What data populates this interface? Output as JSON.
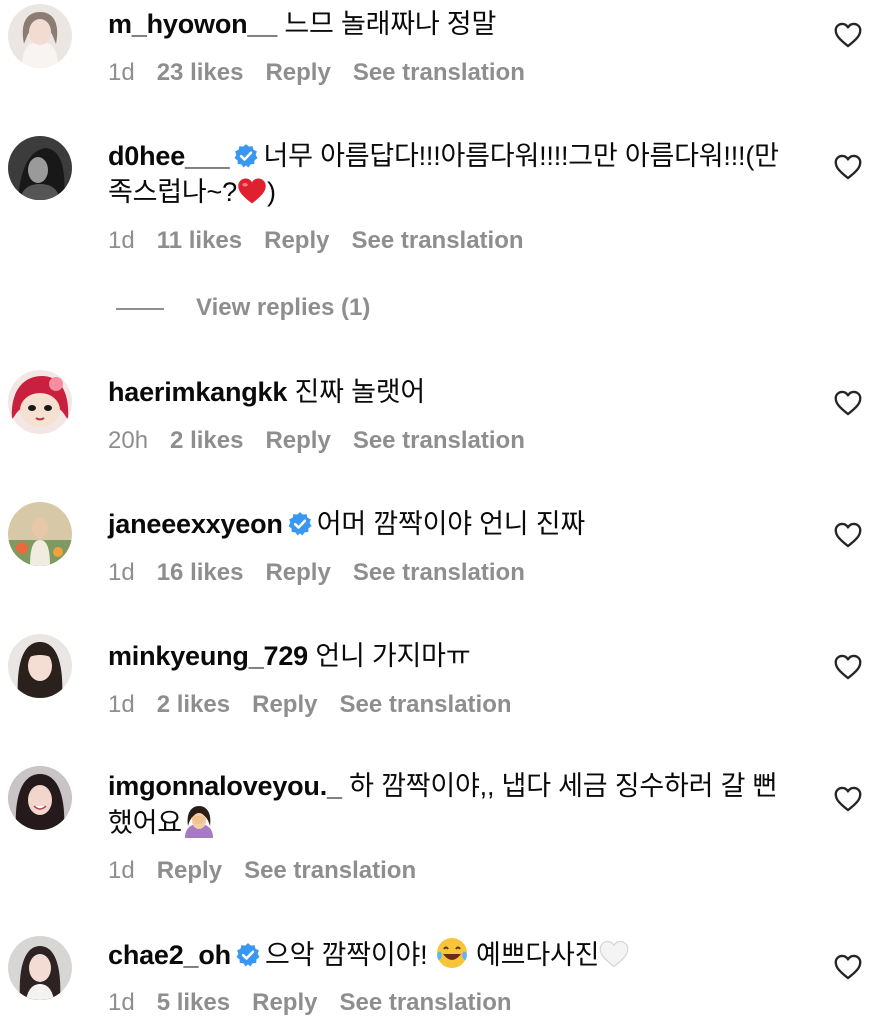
{
  "comments": [
    {
      "username": "m_hyowon__",
      "verified": false,
      "text": "느므 놀래짜나 정말",
      "time": "1d",
      "likes": "23 likes",
      "reply": "Reply",
      "translate": "See translation"
    },
    {
      "username": "d0hee___",
      "verified": true,
      "text": "너무 아름답다!!!아름다워!!!!그만 아름다워!!!(만 족스럽나~?",
      "text_suffix": ")",
      "emoji": "red-heart",
      "time": "1d",
      "likes": "11 likes",
      "reply": "Reply",
      "translate": "See translation",
      "view_replies": "View replies (1)"
    },
    {
      "username": "haerimkangkk",
      "verified": false,
      "text": "진짜 놀랫어",
      "time": "20h",
      "likes": "2 likes",
      "reply": "Reply",
      "translate": "See translation"
    },
    {
      "username": "janeeexxyeon",
      "verified": true,
      "text": "어머 깜짝이야 언니 진짜",
      "time": "1d",
      "likes": "16 likes",
      "reply": "Reply",
      "translate": "See translation"
    },
    {
      "username": "minkyeung_729",
      "verified": false,
      "text": "언니 가지마ㅠ",
      "time": "1d",
      "likes": "2 likes",
      "reply": "Reply",
      "translate": "See translation"
    },
    {
      "username": "imgonnaloveyou._",
      "verified": false,
      "text": "하 깜짝이야,, 냅다 세금 징수하러 갈 뻔 했어요",
      "emoji": "face-palm",
      "time": "1d",
      "reply": "Reply",
      "translate": "See translation"
    },
    {
      "username": "chae2_oh",
      "verified": true,
      "text": "으악 깜짝이야!",
      "text_after": "예쁘다사진",
      "emoji": "face-with-tears-of-joy",
      "emoji_end": "white-heart",
      "time": "1d",
      "likes": "5 likes",
      "reply": "Reply",
      "translate": "See translation"
    }
  ],
  "colors": {
    "text": "#0a0a0a",
    "secondary": "#8e8e8e",
    "verified": "#3897f0"
  },
  "icons": {
    "like": "heart-outline-icon",
    "verified": "verified-badge-icon"
  }
}
